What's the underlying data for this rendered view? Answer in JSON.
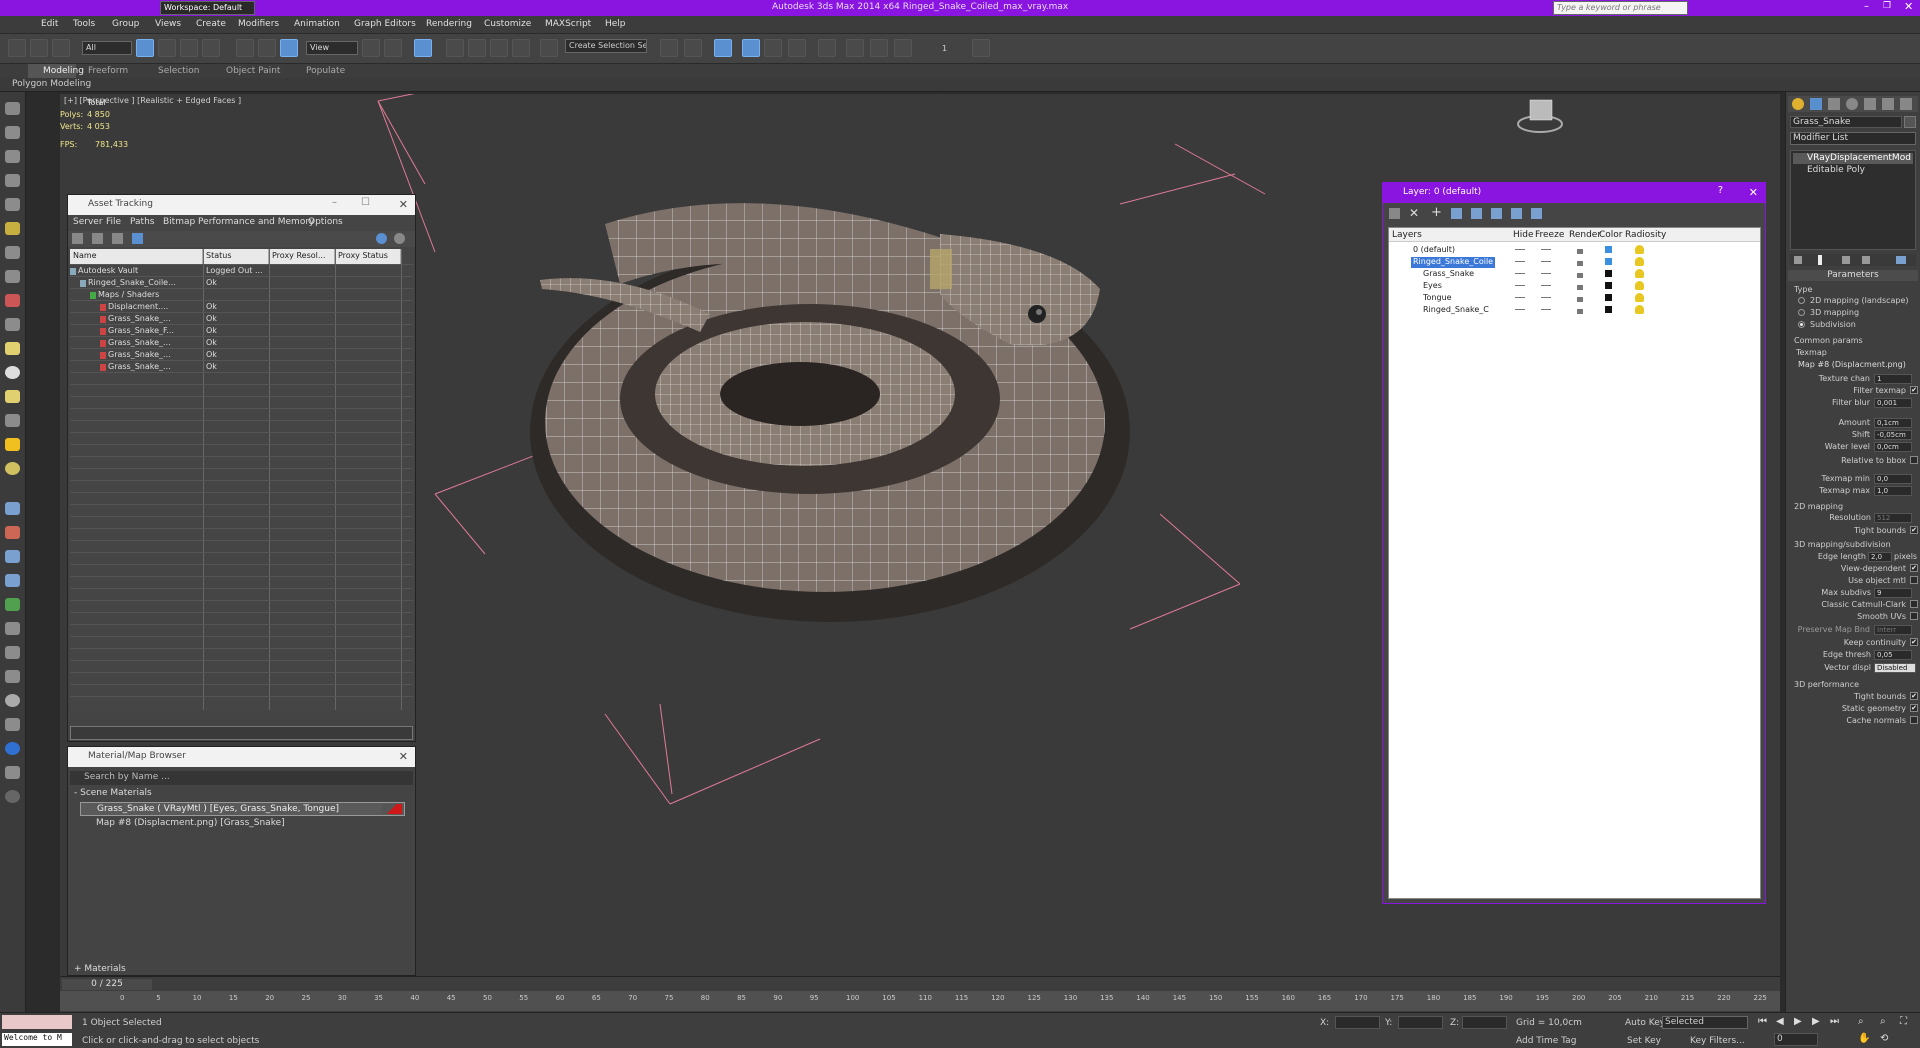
{
  "title": {
    "text": "Autodesk 3ds Max 2014 x64     Ringed_Snake_Coiled_max_vray.max",
    "workspace": "Workspace: Default",
    "search_placeholder": "Type a keyword or phrase"
  },
  "menu": [
    "Edit",
    "Tools",
    "Group",
    "Views",
    "Create",
    "Modifiers",
    "Animation",
    "Graph Editors",
    "Rendering",
    "Customize",
    "MAXScript",
    "Help"
  ],
  "toolbar": {
    "filter": "All",
    "refcoord": "View",
    "selset": "Create Selection Se",
    "num": "1"
  },
  "ribbon": {
    "tabs": [
      "Modeling",
      "Freeform",
      "Selection",
      "Object Paint",
      "Populate"
    ],
    "sub": "Polygon Modeling"
  },
  "viewport": {
    "label": "[+] [Perspective ] [Realistic + Edged Faces ]",
    "total_label": "Total",
    "polys_label": "Polys:",
    "polys": "4 850",
    "verts_label": "Verts:",
    "verts": "4 053",
    "fps_label": "FPS:",
    "fps": "781,433"
  },
  "asset": {
    "title": "Asset Tracking",
    "menu": [
      "Server",
      "File",
      "Paths",
      "Bitmap Performance and Memory",
      "Options"
    ],
    "cols": [
      "Name",
      "Status",
      "Proxy Resol...",
      "Proxy Status"
    ],
    "rows": [
      {
        "name": "Autodesk Vault",
        "status": "Logged Out ...",
        "indent": 0
      },
      {
        "name": "Ringed_Snake_Coile...",
        "status": "Ok",
        "indent": 1
      },
      {
        "name": "Maps / Shaders",
        "status": "",
        "indent": 2
      },
      {
        "name": "Displacment....",
        "status": "Ok",
        "indent": 3
      },
      {
        "name": "Grass_Snake_...",
        "status": "Ok",
        "indent": 3
      },
      {
        "name": "Grass_Snake_F...",
        "status": "Ok",
        "indent": 3
      },
      {
        "name": "Grass_Snake_...",
        "status": "Ok",
        "indent": 3
      },
      {
        "name": "Grass_Snake_...",
        "status": "Ok",
        "indent": 3
      },
      {
        "name": "Grass_Snake_...",
        "status": "Ok",
        "indent": 3
      }
    ]
  },
  "matbrowser": {
    "title": "Material/Map Browser",
    "search": "Search by Name ...",
    "section": "- Scene Materials",
    "items": [
      "Grass_Snake  ( VRayMtl )  [Eyes, Grass_Snake, Tongue]",
      "Map #8 (Displacment.png)  [Grass_Snake]"
    ],
    "footer": "+ Materials"
  },
  "layers": {
    "title": "Layer: 0 (default)",
    "cols": [
      "Layers",
      "Hide",
      "Freeze",
      "Render",
      "Color",
      "Radiosity"
    ],
    "rows": [
      {
        "name": "0 (default)",
        "indent": 0,
        "color": "#3b8fe0"
      },
      {
        "name": "Ringed_Snake_Coile",
        "indent": 0,
        "sel": true,
        "color": "#3b8fe0"
      },
      {
        "name": "Grass_Snake",
        "indent": 1,
        "color": "#111111"
      },
      {
        "name": "Eyes",
        "indent": 1,
        "color": "#111111"
      },
      {
        "name": "Tongue",
        "indent": 1,
        "color": "#111111"
      },
      {
        "name": "Ringed_Snake_C",
        "indent": 1,
        "color": "#111111"
      }
    ]
  },
  "cmd": {
    "object": "Grass_Snake",
    "modlist": "Modifier List",
    "stack": [
      "VRayDisplacementMod",
      "Editable Poly"
    ],
    "params_title": "Parameters",
    "type_label": "Type",
    "types": [
      "2D mapping (landscape)",
      "3D mapping",
      "Subdivision"
    ],
    "common": "Common params",
    "texmap": "Texmap",
    "mapname": "Map #8 (Displacment.png)",
    "fields": [
      {
        "l": "Texture chan",
        "v": "1"
      },
      {
        "l": "Filter texmap",
        "c": "✔"
      },
      {
        "l": "Filter blur",
        "v": "0,001"
      },
      {
        "l": "Amount",
        "v": "0,1cm"
      },
      {
        "l": "Shift",
        "v": "-0,05cm"
      },
      {
        "l": "Water level",
        "v": "0,0cm",
        "c": ""
      },
      {
        "l": "Relative to bbox",
        "c": ""
      },
      {
        "l": "Texmap min",
        "v": "0,0"
      },
      {
        "l": "Texmap max",
        "v": "1,0"
      }
    ],
    "sec2d": "2D mapping",
    "res_label": "Resolution",
    "res": "512",
    "tight_label": "Tight bounds",
    "sec3d": "3D mapping/subdivision",
    "edge_label": "Edge length",
    "edge": "2,0",
    "pixels": "pixels",
    "opts3d": [
      {
        "l": "View-dependent",
        "c": "✔"
      },
      {
        "l": "Use object mtl",
        "c": ""
      }
    ],
    "maxsub_label": "Max subdivs",
    "maxsub": "9",
    "opts3d2": [
      {
        "l": "Classic Catmull-Clark",
        "c": ""
      },
      {
        "l": "Smooth UVs",
        "c": ""
      }
    ],
    "preserve": "Preserve Map Bnd",
    "preserve_v": "Interr",
    "keep": "Keep continuity",
    "edgethresh_label": "Edge thresh",
    "edgethresh": "0,05",
    "vdisp_label": "Vector displ",
    "vdisp": "Disabled",
    "perf": "3D performance",
    "perfopts": [
      {
        "l": "Tight bounds",
        "c": "✔"
      },
      {
        "l": "Static geometry",
        "c": "✔"
      },
      {
        "l": "Cache normals",
        "c": ""
      }
    ]
  },
  "timeline": {
    "frame": "0 / 225",
    "ticks": [
      "0",
      "5",
      "10",
      "15",
      "20",
      "25",
      "30",
      "35",
      "40",
      "45",
      "50",
      "55",
      "60",
      "65",
      "70",
      "75",
      "80",
      "85",
      "90",
      "95",
      "100",
      "105",
      "110",
      "115",
      "120",
      "125",
      "130",
      "135",
      "140",
      "145",
      "150",
      "155",
      "160",
      "165",
      "170",
      "175",
      "180",
      "185",
      "190",
      "195",
      "200",
      "205",
      "210",
      "215",
      "220",
      "225"
    ]
  },
  "status": {
    "welcome": "Welcome to M",
    "selected": "1 Object Selected",
    "hint": "Click or click-and-drag to select objects",
    "x": "X:",
    "y": "Y:",
    "z": "Z:",
    "grid": "Grid = 10,0cm",
    "addtime": "Add Time Tag",
    "autokey": "Auto Key",
    "setkey": "Set Key",
    "selmode": "Selected",
    "keyfilters": "Key Filters...",
    "frameval": "0"
  }
}
